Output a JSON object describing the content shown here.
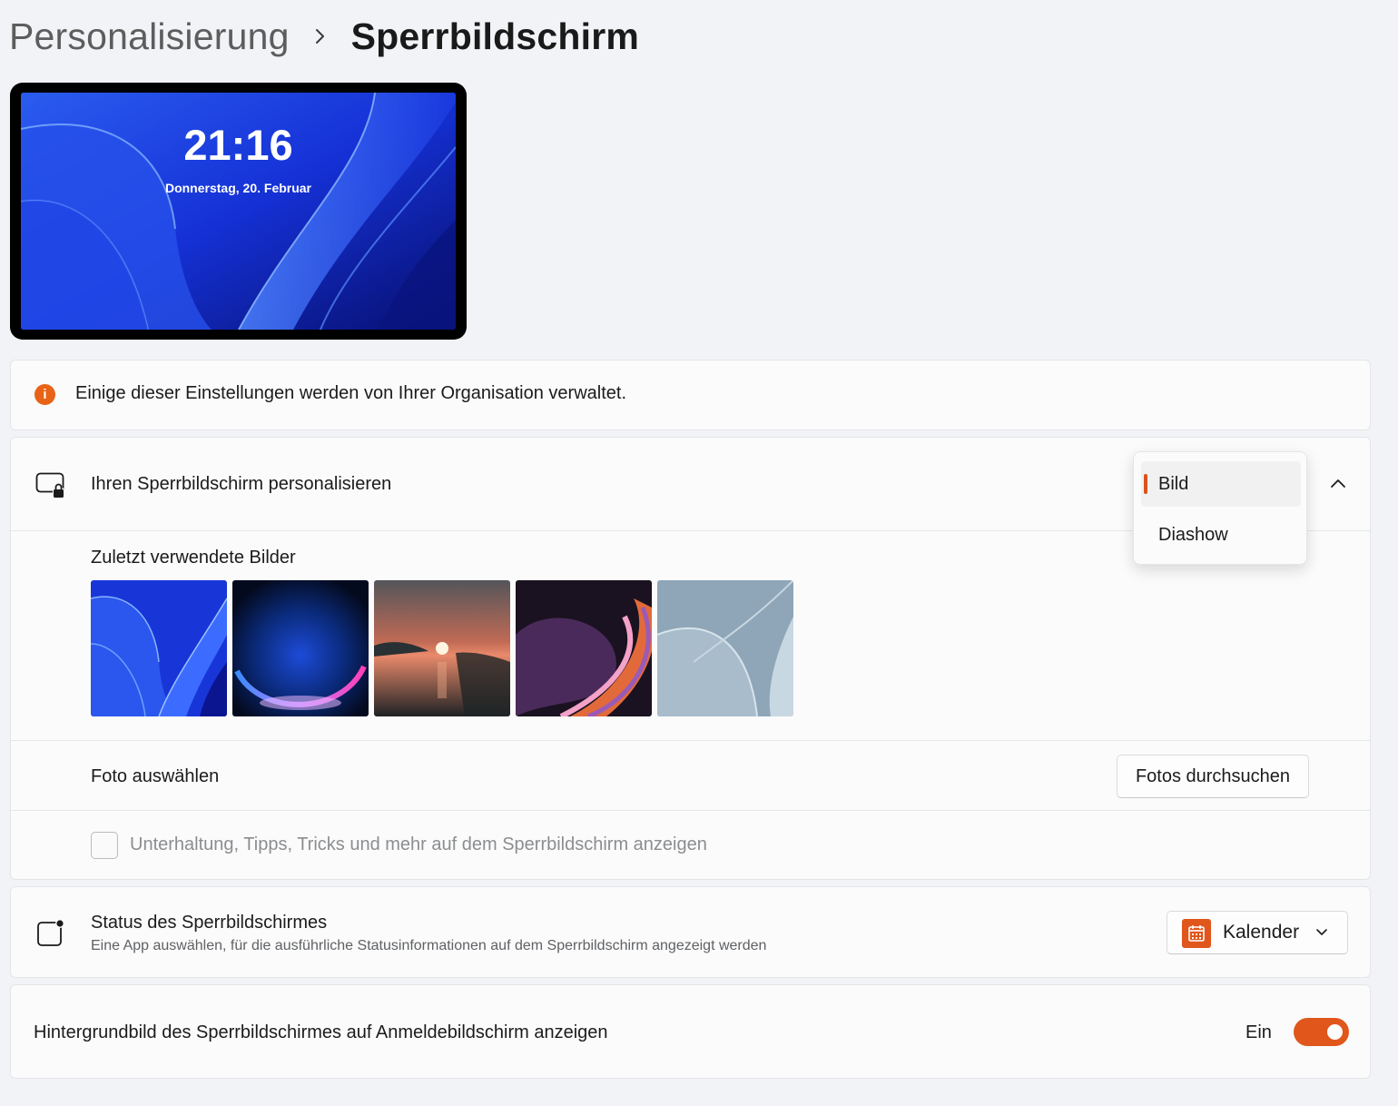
{
  "breadcrumb": {
    "parent": "Personalisierung",
    "current": "Sperrbildschirm"
  },
  "preview": {
    "time": "21:16",
    "date": "Donnerstag, 20. Februar"
  },
  "notice": {
    "icon": "info-icon",
    "text": "Einige dieser Einstellungen werden von Ihrer Organisation verwaltet."
  },
  "personalize": {
    "title": "Ihren Sperrbildschirm personalisieren",
    "icon": "lock-screen-icon",
    "dropdown": {
      "options": [
        "Bild",
        "Diashow"
      ],
      "selected": "Bild"
    },
    "recent_label": "Zuletzt verwendete Bilder",
    "recent_images": [
      "bloom-blue",
      "glow-purple",
      "sunset-lake",
      "ribbon-dark",
      "bloom-gray"
    ],
    "choose_label": "Foto auswählen",
    "browse_button": "Fotos durchsuchen",
    "fun_facts_label": "Unterhaltung, Tipps, Tricks und mehr auf dem Sperrbildschirm anzeigen",
    "fun_facts_checked": false
  },
  "status": {
    "title": "Status des Sperrbildschirmes",
    "subtitle": "Eine App auswählen, für die ausführliche Statusinformationen auf dem Sperrbildschirm angezeigt werden",
    "selected_app": "Kalender",
    "app_icon": "calendar-icon"
  },
  "signin": {
    "label": "Hintergrundbild des Sperrbildschirmes auf Anmeldebildschirm anzeigen",
    "state": "Ein",
    "on": true
  },
  "colors": {
    "accent": "#e0561b",
    "background": "#f1f3f6",
    "card": "#fbfbfb"
  }
}
